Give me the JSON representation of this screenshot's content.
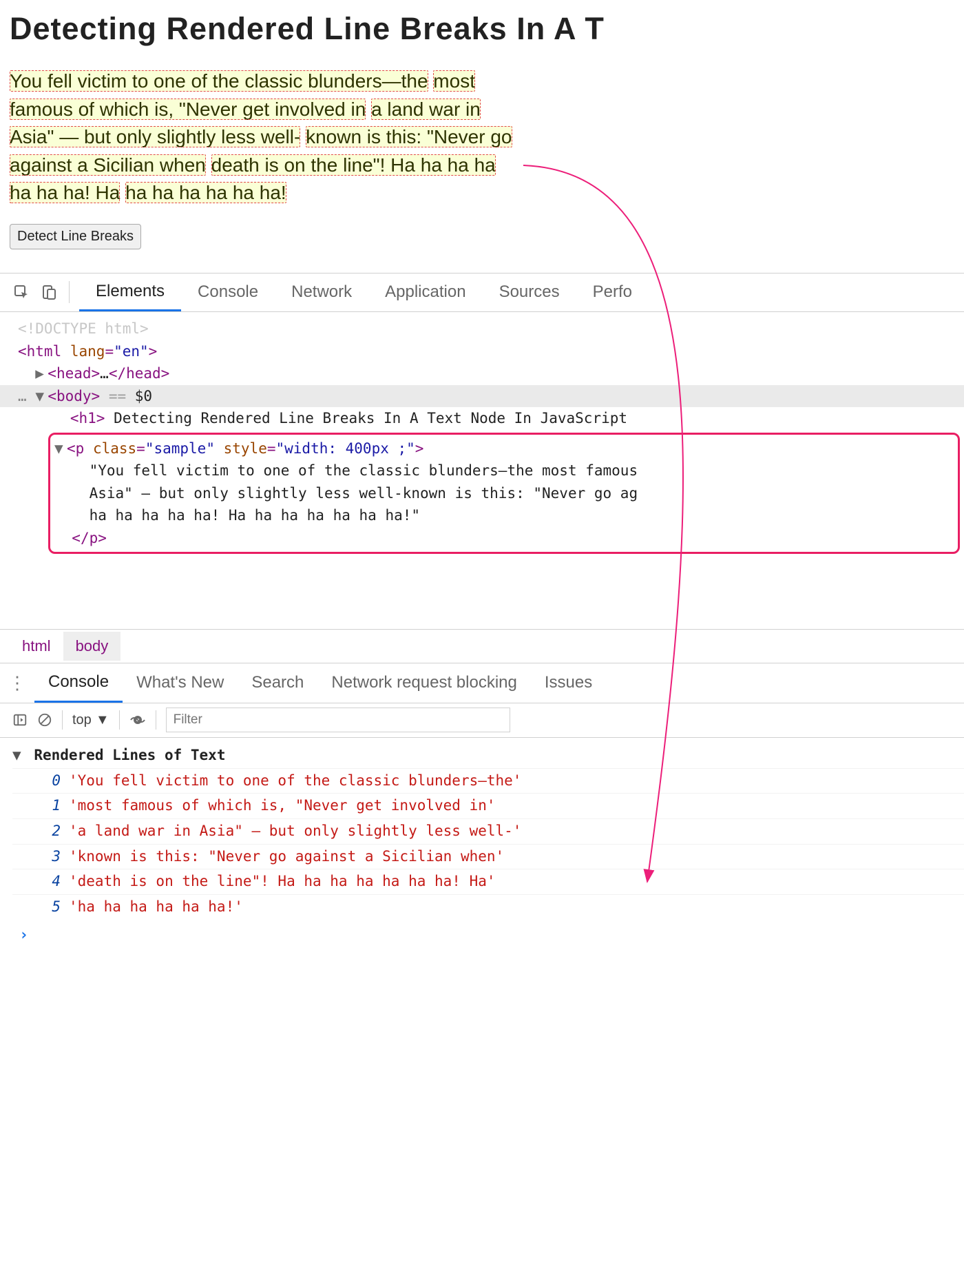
{
  "page": {
    "title_visible": "Detecting Rendered Line Breaks In A T",
    "sample_lines": [
      "You fell victim to one of the classic blunders—the",
      "most famous of which is, \"Never get involved in",
      "a land war in Asia\" — but only slightly less well-",
      "known is this: \"Never go against a Sicilian when",
      "death is on the line\"! Ha ha ha ha ha ha ha! Ha",
      "ha ha ha ha ha ha!"
    ],
    "button_label": "Detect Line Breaks"
  },
  "devtools": {
    "tabs": [
      "Elements",
      "Console",
      "Network",
      "Application",
      "Sources",
      "Perfo"
    ],
    "active_tab": 0,
    "elements": {
      "doctype": "<!DOCTYPE html>",
      "html_open": "<html ",
      "html_attr": "lang",
      "html_attr_val": "\"en\"",
      "head": "<head>",
      "head_ellipsis": "…",
      "head_close": "</head>",
      "body": "<body>",
      "selected_marker_eq": " == ",
      "selected_marker_ref": "$0",
      "selected_prefix": "…",
      "h1_open": "<h1>",
      "h1_text": " Detecting Rendered Line Breaks In A Text Node In JavaScript ",
      "p_open_tag": "<p ",
      "p_class_attr": "class",
      "p_class_val": "\"sample\"",
      "p_style_attr": "style",
      "p_style_val": "\"width: 400px ;\"",
      "p_text_lines": [
        "\"You fell victim to one of the classic blunders—the most famous",
        "Asia\" — but only slightly less well-known is this: \"Never go ag",
        "ha ha ha ha ha! Ha ha ha ha ha ha ha!\""
      ],
      "p_close": "</p>"
    },
    "breadcrumbs": [
      "html",
      "body"
    ]
  },
  "console": {
    "tabs": [
      "Console",
      "What's New",
      "Search",
      "Network request blocking",
      "Issues"
    ],
    "active_tab": 0,
    "context": "top",
    "filter_placeholder": "Filter",
    "group_title": "Rendered Lines of Text",
    "lines": [
      "'You fell victim to one of the classic blunders—the'",
      "'most famous of which is, \"Never get involved in'",
      "'a land war in Asia\" — but only slightly less well-'",
      "'known is this: \"Never go against a Sicilian when'",
      "'death is on the line\"! Ha ha ha ha ha ha ha! Ha'",
      "'ha ha ha ha ha ha!'"
    ]
  }
}
